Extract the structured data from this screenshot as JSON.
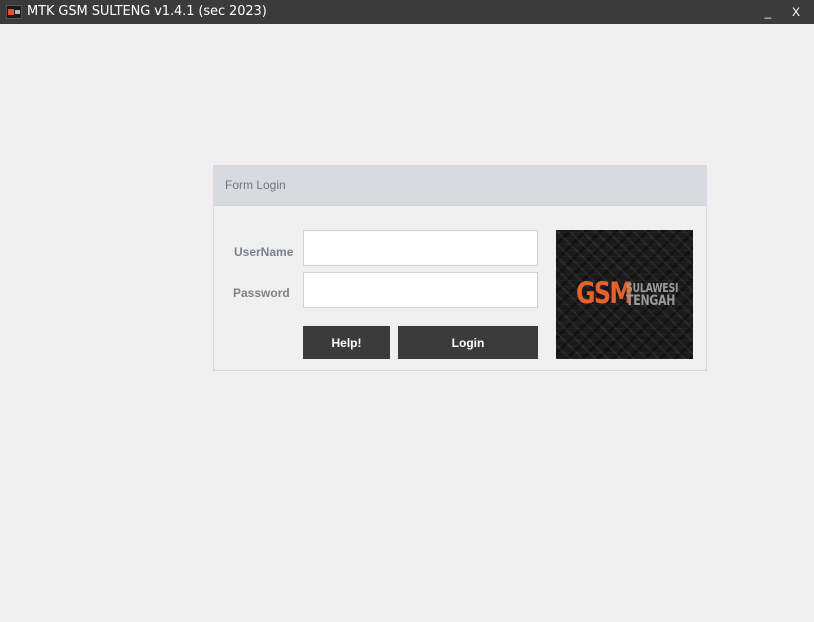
{
  "window": {
    "title": "MTK GSM SULTENG v1.4.1 (sec 2023)",
    "minimize_label": "_",
    "close_label": "X"
  },
  "login_form": {
    "header": "Form Login",
    "username_label": "UserName",
    "username_value": "",
    "password_label": "Password",
    "password_value": "",
    "help_button": "Help!",
    "login_button": "Login"
  },
  "logo": {
    "main": "GSM",
    "line1": "SULAWESI",
    "line2": "TENGAH",
    "accent_color": "#e8612c"
  },
  "colors": {
    "titlebar": "#3b3b3b",
    "button": "#3b3b3b",
    "header": "#d7dbdf",
    "background": "#f0f0f0"
  }
}
